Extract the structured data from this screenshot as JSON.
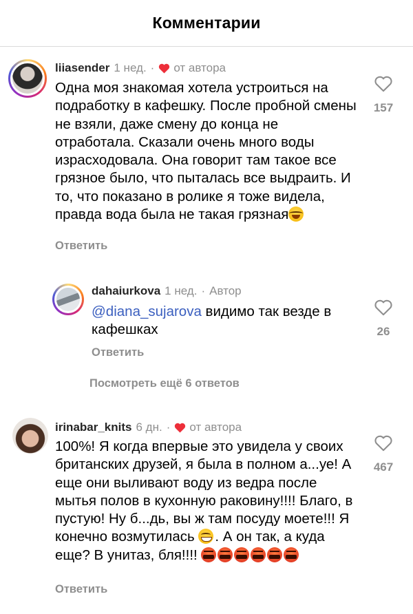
{
  "header": {
    "title": "Комментарии"
  },
  "comments": [
    {
      "username": "liiasender",
      "time": "1 нед.",
      "dot": "·",
      "badge": "от автора",
      "text": "Одна моя знакомая хотела устроиться на подработку в кафешку. После пробной смены не взяли, даже смену до конца не отработала. Сказали очень много воды израсходовала. Она говорит там такое все грязное было, что пыталась все выдраить. И то, что показано в ролике я тоже видела, правда вода была не такая грязная",
      "reply_label": "Ответить",
      "likes": "157"
    },
    {
      "username": "dahaiurkova",
      "time": "1 нед.",
      "dot": "·",
      "badge": "Автор",
      "mention": "@diana_sujarova",
      "text": " видимо так везде в кафешках",
      "reply_label": "Ответить",
      "likes": "26"
    },
    {
      "username": "irinabar_knits",
      "time": "6 дн.",
      "dot": "·",
      "badge": "от автора",
      "text_part1": "100%! Я когда впервые это увидела у своих британских друзей, я была в полном а...уе! А еще они выливают воду из ведра после мытья полов в кухонную раковину!!!! Благо, в пустую! Ну б...дь, вы ж там посуду моете!!! Я конечно возмутилась ",
      "text_part2": ". А он так, а куда еще? В унитаз, бля!!!! ",
      "reply_label": "Ответить",
      "likes": "467"
    }
  ],
  "thread": {
    "more_replies": "Посмотреть ещё 6 ответов"
  },
  "colors": {
    "heart_red": "#ed2f3a",
    "meta_gray": "#8e8e8e",
    "mention_blue": "#3b5fbf"
  },
  "icons": {
    "like": "heart-outline-icon",
    "author_like": "heart-filled-icon",
    "laugh": "tears-of-joy-emoji",
    "grin": "grinning-squinting-emoji",
    "curse": "face-with-symbols-emoji"
  }
}
